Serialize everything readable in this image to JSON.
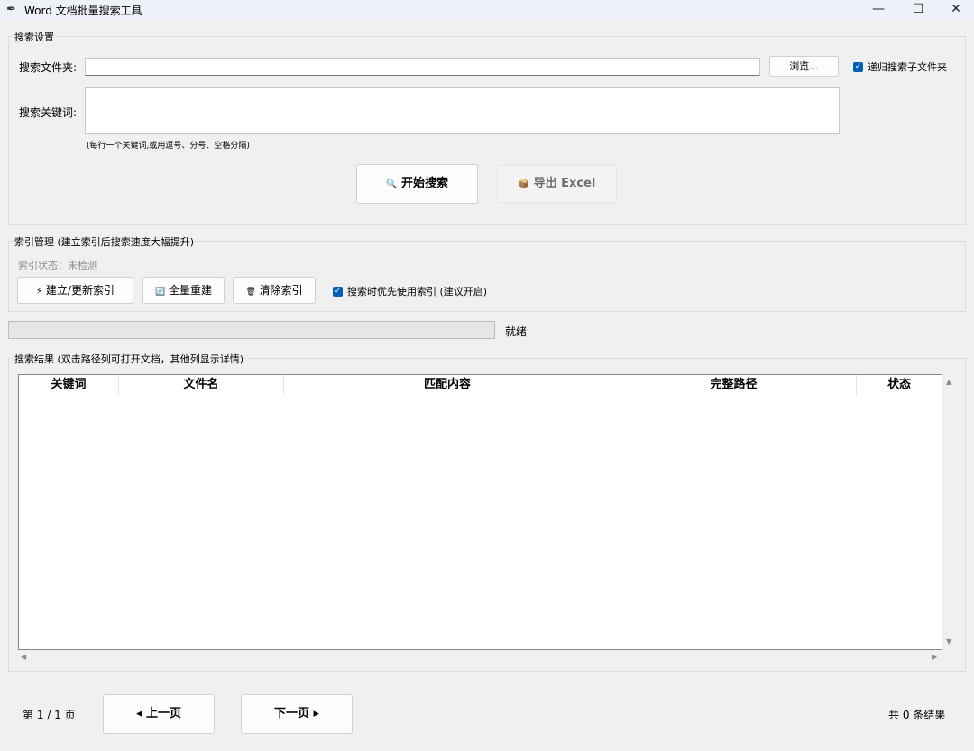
{
  "window": {
    "title": "Word 文档批量搜索工具",
    "minimize_glyph": "—",
    "maximize_glyph": "☐",
    "close_glyph": "✕",
    "icon": "feather-icon"
  },
  "search_settings": {
    "group_title": "搜索设置",
    "folder_label": "搜索文件夹:",
    "folder_value": "",
    "browse_label": "浏览...",
    "recursive_label": "递归搜索子文件夹",
    "recursive_checked": true,
    "keyword_label": "搜索关键词:",
    "keyword_value": "",
    "keyword_hint": "(每行一个关键词,或用逗号、分号、空格分隔)",
    "start_button": {
      "icon": "magnifier-icon",
      "glyph": "🔍",
      "label": "开始搜索"
    },
    "export_button": {
      "icon": "package-icon",
      "glyph": "📦",
      "label": "导出 Excel",
      "enabled": false
    }
  },
  "index_management": {
    "group_title": "索引管理 (建立索引后搜索速度大幅提升)",
    "status_text": "索引状态：未检测",
    "build_button": {
      "icon": "lightning-icon",
      "glyph": "⚡",
      "label": "建立/更新索引"
    },
    "rebuild_button": {
      "icon": "rebuild-icon",
      "glyph": "🔄",
      "label": "全量重建"
    },
    "clear_button": {
      "icon": "trash-icon",
      "glyph": "🗑",
      "label": "清除索引"
    },
    "prefer_index_label": "搜索时优先使用索引 (建议开启)",
    "prefer_index_checked": true
  },
  "progress": {
    "value": 0,
    "status": "就绪"
  },
  "results": {
    "group_title": "搜索结果 (双击路径列可打开文档，其他列显示详情)",
    "columns": [
      "关键词",
      "文件名",
      "匹配内容",
      "完整路径",
      "状态"
    ],
    "rows": []
  },
  "pagination": {
    "page_info": "第 1 / 1 页",
    "prev_label": "◂ 上一页",
    "next_label": "下一页 ▸",
    "total": "共 0 条结果"
  }
}
